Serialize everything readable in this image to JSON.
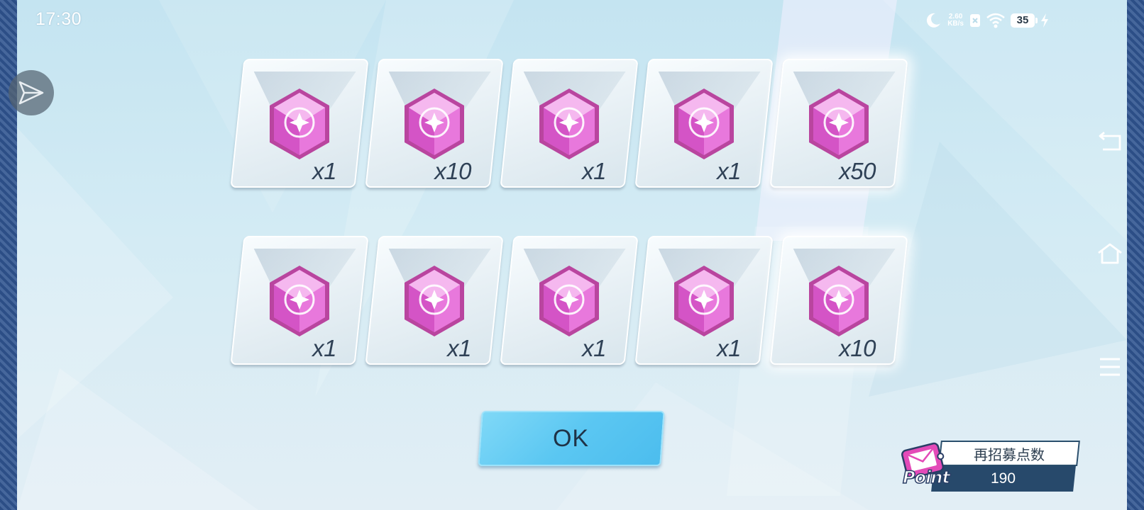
{
  "status_bar": {
    "time": "17:30",
    "net_speed_value": "2.60",
    "net_speed_unit": "KB/s",
    "battery_level": "35",
    "icons": [
      "moon-icon",
      "close-box-icon",
      "wifi-icon",
      "battery-icon",
      "charging-bolt-icon"
    ]
  },
  "system_nav": {
    "icons": [
      "floating-send-icon",
      "back-icon",
      "home-icon",
      "menu-icon"
    ]
  },
  "rewards": {
    "row1": [
      {
        "quantity": "x1"
      },
      {
        "quantity": "x10"
      },
      {
        "quantity": "x1"
      },
      {
        "quantity": "x1"
      },
      {
        "quantity": "x50",
        "highlighted": true
      }
    ],
    "row2": [
      {
        "quantity": "x1"
      },
      {
        "quantity": "x1"
      },
      {
        "quantity": "x1"
      },
      {
        "quantity": "x1"
      },
      {
        "quantity": "x10",
        "highlighted": true
      }
    ],
    "item_icon": "pink-crystal-gem-icon"
  },
  "ok_button": {
    "label": "OK"
  },
  "recruit_points": {
    "title": "再招募点数",
    "value": "190",
    "logo_text": "Point"
  },
  "colors": {
    "background": "#c9e6f2",
    "ok_button": "#5bc7f2",
    "points_dark": "#27496b",
    "gem_pink": "#e05ad6",
    "quantity_text": "#2f4156"
  }
}
